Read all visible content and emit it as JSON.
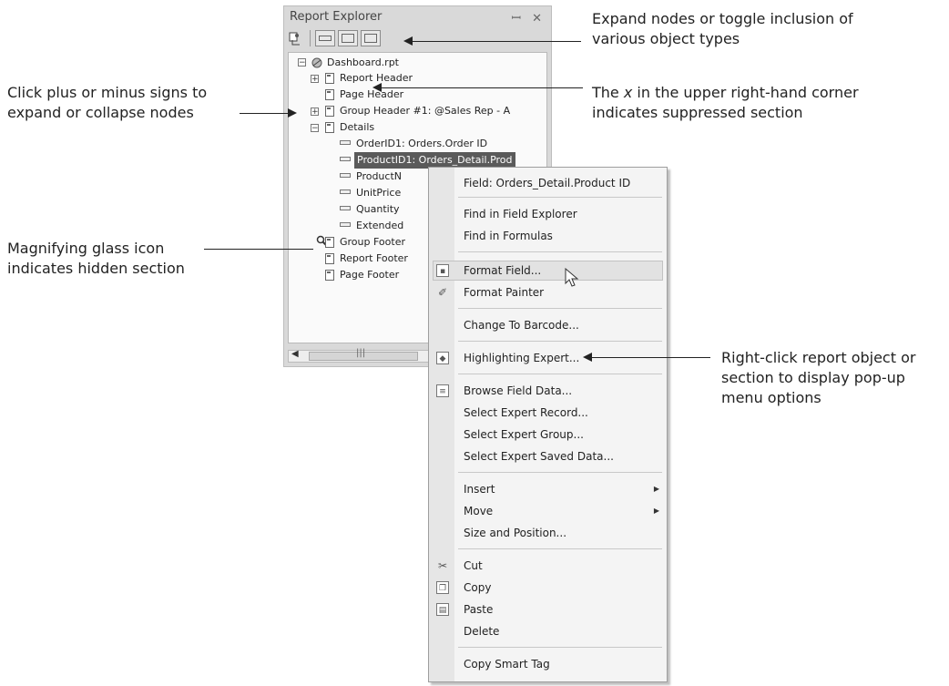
{
  "panel": {
    "title": "Report Explorer",
    "pin_icon": "pin-icon",
    "close_icon": "close-icon"
  },
  "tree": {
    "root": "Dashboard.rpt",
    "nodes": [
      "Report Header",
      "Page Header",
      "Group Header #1: @Sales Rep - A",
      "Details",
      "OrderID1: Orders.Order ID",
      "ProductID1: Orders_Detail.Prod",
      "ProductN",
      "UnitPrice",
      "Quantity",
      "Extended",
      "Group Footer",
      "Report Footer",
      "Page Footer"
    ]
  },
  "menu": {
    "items": [
      "Field: Orders_Detail.Product ID",
      "Find in Field Explorer",
      "Find in Formulas",
      "Format Field...",
      "Format Painter",
      "Change To Barcode...",
      "Highlighting Expert...",
      "Browse Field Data...",
      "Select Expert Record...",
      "Select Expert Group...",
      "Select Expert Saved Data...",
      "Insert",
      "Move",
      "Size and Position...",
      "Cut",
      "Copy",
      "Paste",
      "Delete",
      "Copy Smart Tag"
    ]
  },
  "callouts": {
    "toolbar_line1": "Expand nodes or toggle inclusion of",
    "toolbar_line2": "various object types",
    "plusminus_line1": "Click plus or minus signs to",
    "plusminus_line2": "expand or collapse nodes",
    "x_line1": "The x in the upper right-hand corner",
    "x_line2": "indicates suppressed section",
    "glass_line1": "Magnifying glass icon",
    "glass_line2": "indicates hidden section",
    "rightclick_line1": "Right-click report object or",
    "rightclick_line2": "section to display pop-up",
    "rightclick_line3": "menu options"
  }
}
